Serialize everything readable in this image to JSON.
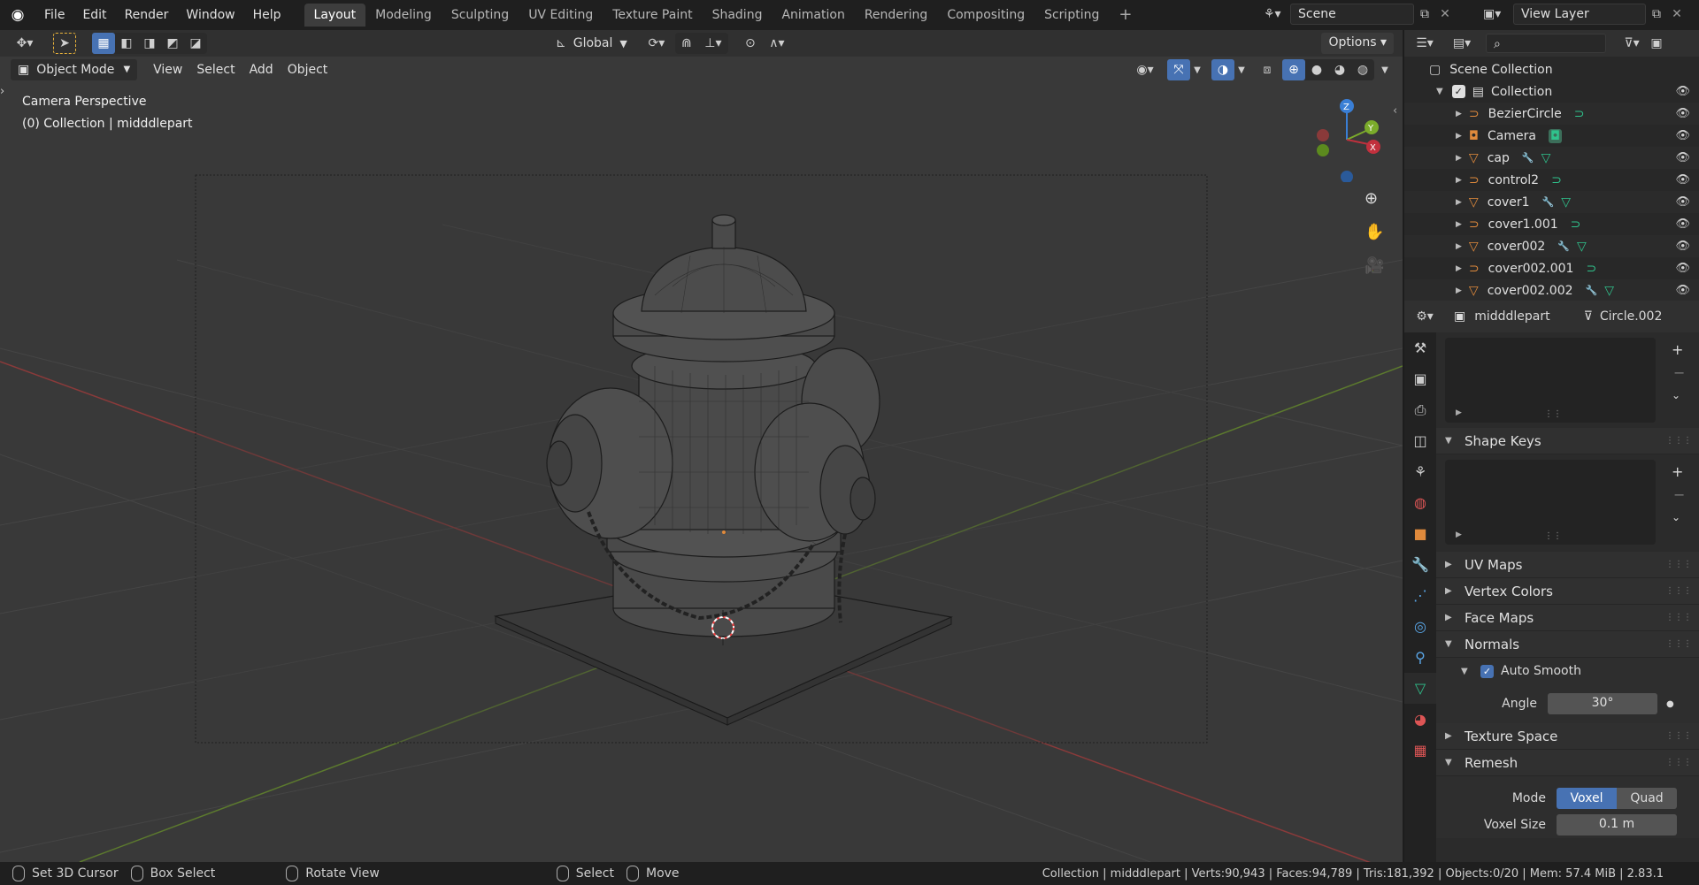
{
  "menus": [
    "File",
    "Edit",
    "Render",
    "Window",
    "Help"
  ],
  "workspaces": [
    "Layout",
    "Modeling",
    "Sculpting",
    "UV Editing",
    "Texture Paint",
    "Shading",
    "Animation",
    "Rendering",
    "Compositing",
    "Scripting"
  ],
  "active_workspace": "Layout",
  "scene": "Scene",
  "view_layer": "View Layer",
  "toolbar": {
    "orientation": "Global",
    "options": "Options"
  },
  "viewport": {
    "mode": "Object Mode",
    "menus": [
      "View",
      "Select",
      "Add",
      "Object"
    ],
    "overlay_title": "Camera Perspective",
    "overlay_subtitle": "(0) Collection | midddlepart",
    "gizmo_axes": {
      "z": "Z",
      "y": "Y",
      "x": "X"
    }
  },
  "outliner": {
    "root": "Scene Collection",
    "collection": "Collection",
    "items": [
      {
        "name": "BezierCircle",
        "type": "curve"
      },
      {
        "name": "Camera",
        "type": "camera"
      },
      {
        "name": "cap",
        "type": "mesh"
      },
      {
        "name": "control2",
        "type": "curve"
      },
      {
        "name": "cover1",
        "type": "mesh"
      },
      {
        "name": "cover1.001",
        "type": "curve"
      },
      {
        "name": "cover002",
        "type": "mesh"
      },
      {
        "name": "cover002.001",
        "type": "curve"
      },
      {
        "name": "cover002.002",
        "type": "mesh"
      }
    ]
  },
  "properties": {
    "object_name": "midddlepart",
    "data_name": "Circle.002",
    "panels": {
      "shape_keys": "Shape Keys",
      "uv_maps": "UV Maps",
      "vertex_colors": "Vertex Colors",
      "face_maps": "Face Maps",
      "normals": "Normals",
      "auto_smooth": "Auto Smooth",
      "angle_label": "Angle",
      "angle_value": "30°",
      "texture_space": "Texture Space",
      "remesh": "Remesh",
      "mode_label": "Mode",
      "mode_voxel": "Voxel",
      "mode_quad": "Quad",
      "voxel_size_label": "Voxel Size",
      "voxel_size_value": "0.1 m"
    }
  },
  "statusbar": {
    "hint1": "Set 3D Cursor",
    "hint2": "Box Select",
    "hint3": "Rotate View",
    "hint4": "Select",
    "hint5": "Move",
    "stats": "Collection | midddlepart | Verts:90,943 | Faces:94,789 | Tris:181,392 | Objects:0/20 | Mem: 57.4 MiB | 2.83.1"
  },
  "colors": {
    "accent": "#4772b3",
    "x_axis": "#c1303d",
    "y_axis": "#7bab2b",
    "z_axis": "#3a7fd6",
    "curve_icon": "#e08a3c",
    "modifier_icon": "#5aa7e8",
    "data_icon": "#2fc28c"
  }
}
